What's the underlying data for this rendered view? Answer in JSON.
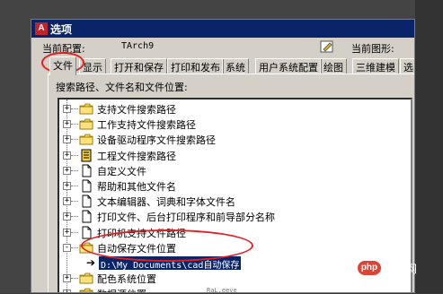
{
  "window": {
    "app_icon": "A",
    "title": "选项"
  },
  "profile": {
    "label": "当前配置:",
    "value": "TArch9",
    "drawing_label": "当前图形:",
    "drawing_icon": "drawing-icon"
  },
  "tabs": [
    {
      "label": "文件",
      "active": true
    },
    {
      "label": "显示"
    },
    {
      "label": "打开和保存"
    },
    {
      "label": "打印和发布"
    },
    {
      "label": "系统"
    },
    {
      "label": "用户系统配置"
    },
    {
      "label": "绘图"
    },
    {
      "label": "三维建模"
    },
    {
      "label": "选"
    }
  ],
  "panel": {
    "label": "搜索路径、文件名和文件位置:"
  },
  "tree": {
    "items": [
      {
        "label": "支持文件搜索路径",
        "icon": "folder-icon",
        "expander": "+"
      },
      {
        "label": "工作支持文件搜索路径",
        "icon": "folder-icon",
        "expander": "+"
      },
      {
        "label": "设备驱动程序文件搜索路径",
        "icon": "folder-icon",
        "expander": "+"
      },
      {
        "label": "工程文件搜索路径",
        "icon": "project-icon",
        "expander": "+"
      },
      {
        "label": "自定义文件",
        "icon": "document-icon",
        "expander": "+"
      },
      {
        "label": "帮助和其他文件名",
        "icon": "document-icon",
        "expander": "+"
      },
      {
        "label": "文本编辑器、词典和字体文件名",
        "icon": "document-icon",
        "expander": "+"
      },
      {
        "label": "打印文件、后台打印程序和前导部分名称",
        "icon": "document-icon",
        "expander": "+"
      },
      {
        "label": "打印机支持文件路径",
        "icon": "document-icon",
        "expander": "+"
      },
      {
        "label": "自动保存文件位置",
        "icon": "folder-icon",
        "expander": "-"
      },
      {
        "label": "配色系统位置",
        "icon": "folder-icon",
        "expander": "+"
      },
      {
        "label": "数据源位置",
        "icon": "folder-icon",
        "expander": "+"
      }
    ],
    "child": {
      "arrow": "➔",
      "value": "D:\\My Documents\\cad自动保存"
    }
  },
  "watermark": {
    "logo": "php",
    "text": "中文网"
  },
  "bottom_text": "RaL.eeve",
  "colors": {
    "titlebar": "#0a246a",
    "annotation": "#e02020",
    "dialog": "#d4d0c8"
  }
}
